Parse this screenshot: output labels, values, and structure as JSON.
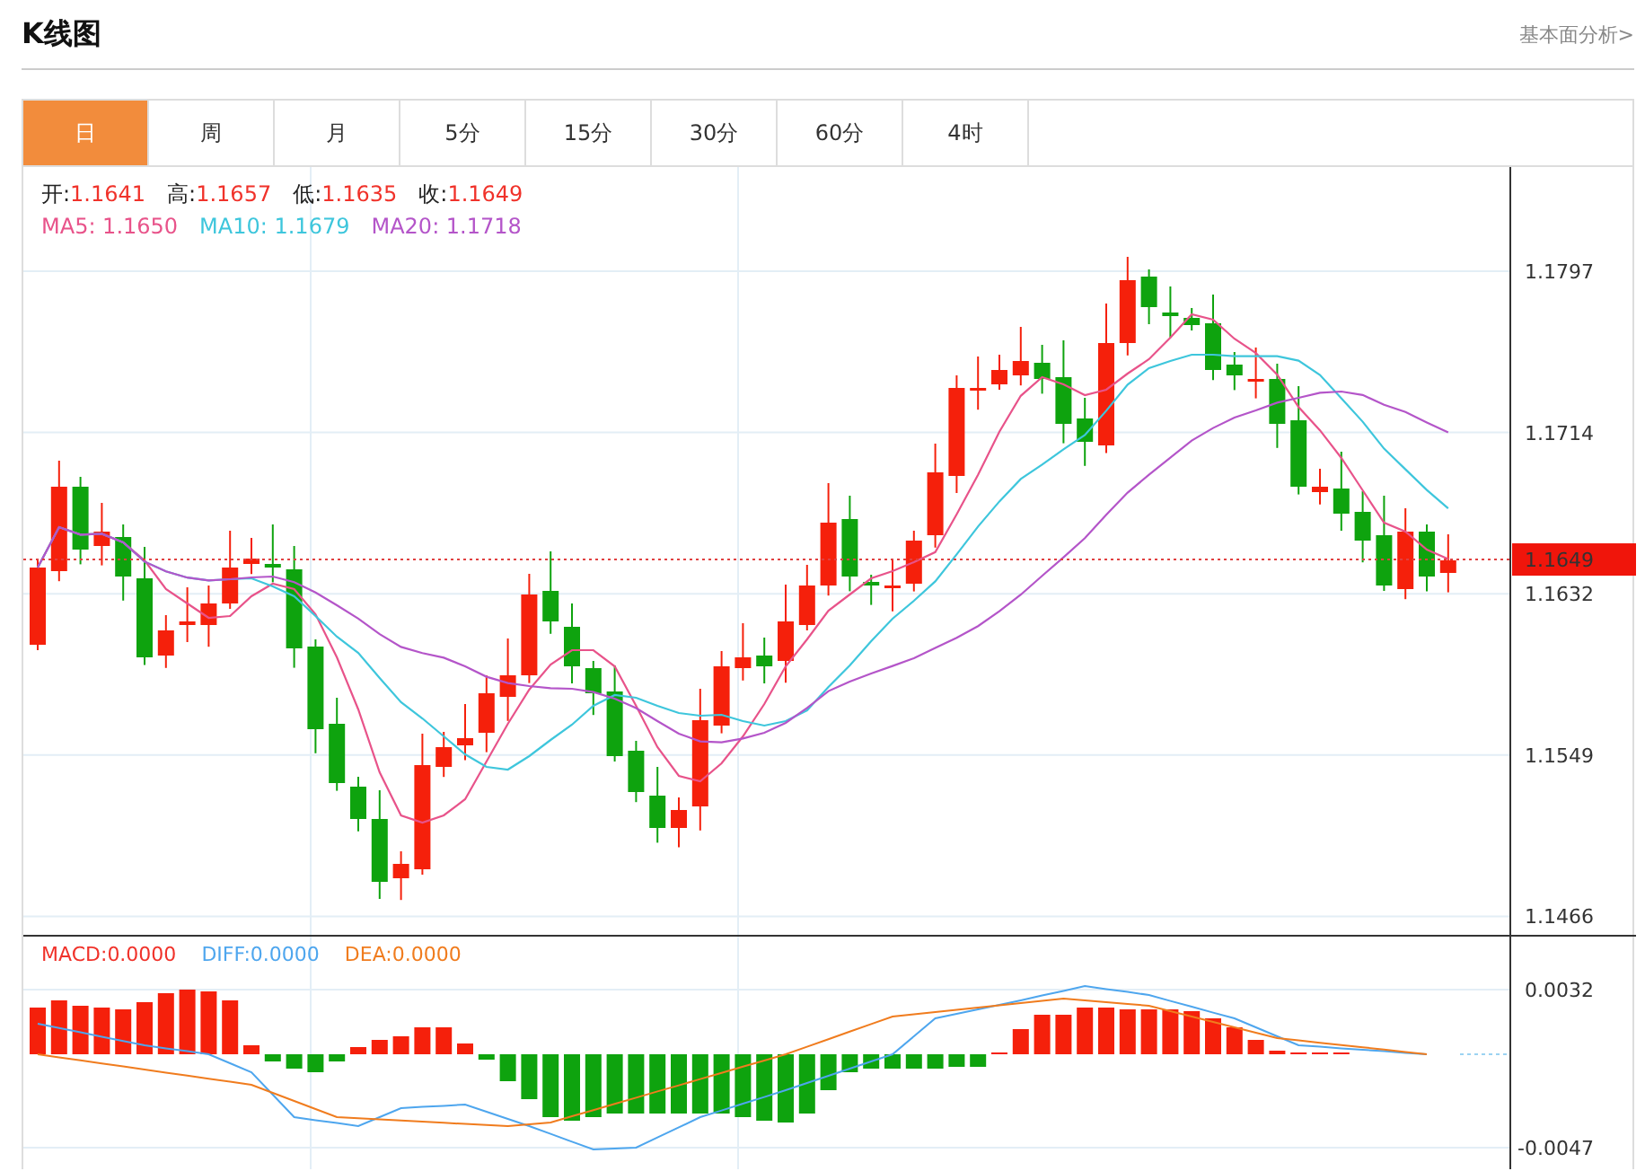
{
  "header": {
    "title": "K线图",
    "link": "基本面分析>"
  },
  "tabs": [
    {
      "label": "日",
      "selected": true
    },
    {
      "label": "周",
      "selected": false
    },
    {
      "label": "月",
      "selected": false
    },
    {
      "label": "5分",
      "selected": false
    },
    {
      "label": "15分",
      "selected": false
    },
    {
      "label": "30分",
      "selected": false
    },
    {
      "label": "60分",
      "selected": false
    },
    {
      "label": "4时",
      "selected": false
    }
  ],
  "ohlc": [
    {
      "label": "开:",
      "value": "1.1641"
    },
    {
      "label": "高:",
      "value": "1.1657"
    },
    {
      "label": "低:",
      "value": "1.1635"
    },
    {
      "label": "收:",
      "value": "1.1649"
    }
  ],
  "moving_averages": [
    {
      "label": "MA5:",
      "value": "1.1650",
      "color": "#e8538a"
    },
    {
      "label": "MA10:",
      "value": "1.1679",
      "color": "#3ec6dc"
    },
    {
      "label": "MA20:",
      "value": "1.1718",
      "color": "#b455c9"
    }
  ],
  "price_axis": [
    "1.1797",
    "1.1714",
    "1.1632",
    "1.1549",
    "1.1466"
  ],
  "current_price": "1.1649",
  "macd_legend": [
    {
      "label": "MACD:",
      "value": "0.0000",
      "color": "#f0322a"
    },
    {
      "label": "DIFF:",
      "value": "0.0000",
      "color": "#4ea6ee"
    },
    {
      "label": "DEA:",
      "value": "0.0000",
      "color": "#f07c1e"
    }
  ],
  "macd_axis": [
    "0.0032",
    "-0.0047"
  ]
}
